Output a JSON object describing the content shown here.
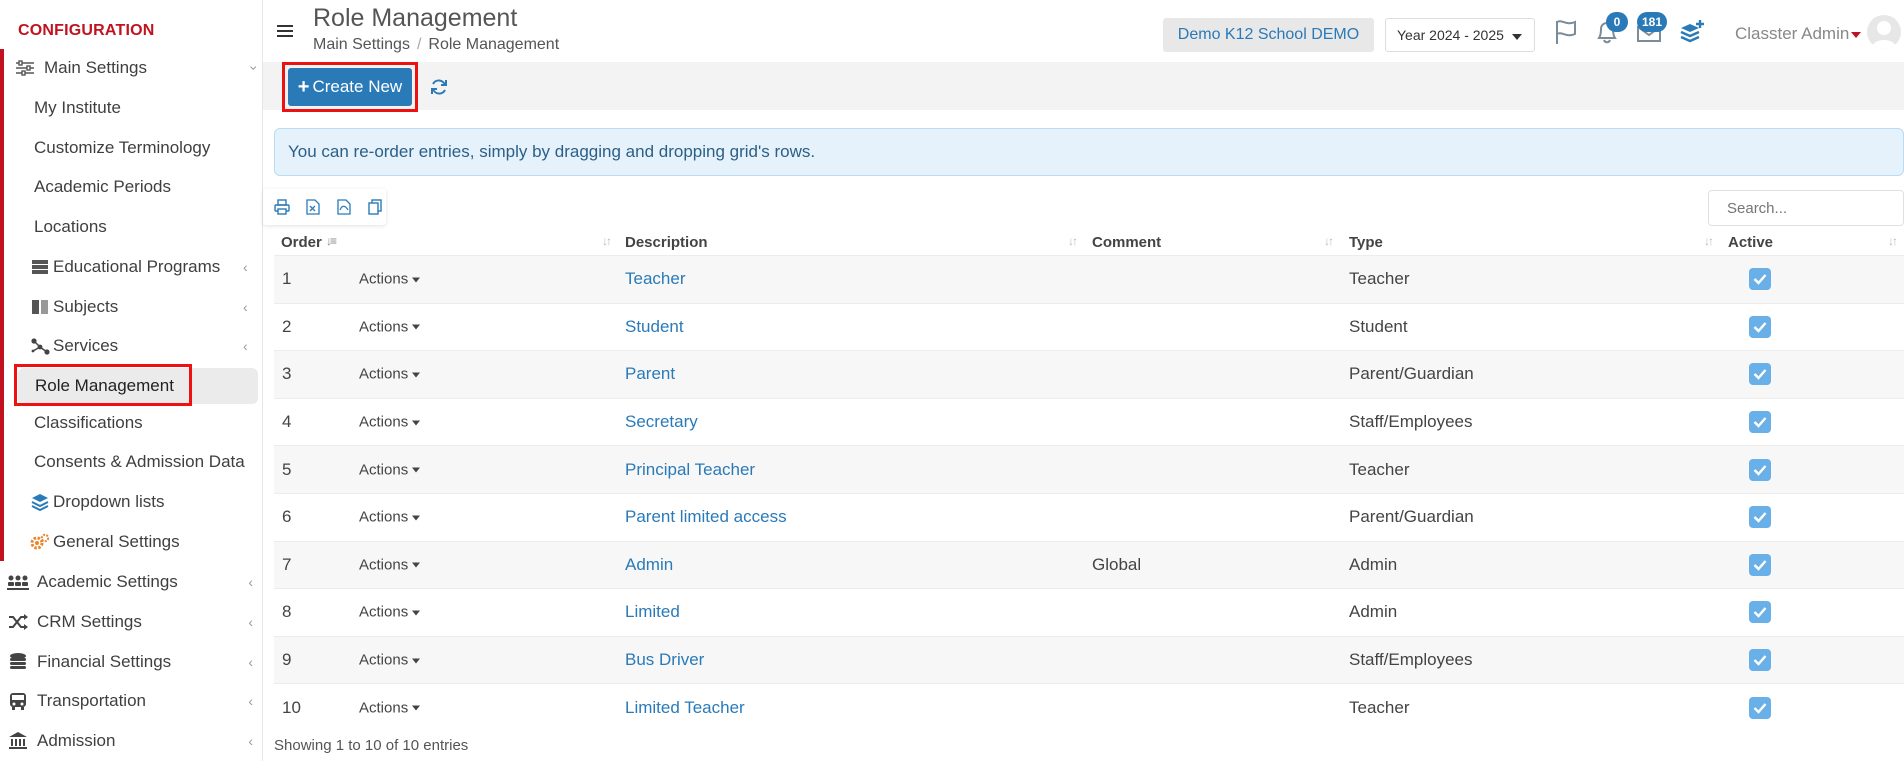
{
  "sidebar": {
    "section_title": "CONFIGURATION",
    "main_settings": "Main Settings",
    "sub_items": [
      {
        "label": "My Institute"
      },
      {
        "label": "Customize Terminology"
      },
      {
        "label": "Academic Periods"
      },
      {
        "label": "Locations"
      },
      {
        "label": "Educational Programs",
        "icon": "server-icon"
      },
      {
        "label": "Subjects",
        "icon": "book-icon"
      },
      {
        "label": "Services",
        "icon": "network-icon"
      },
      {
        "label": "Role Management",
        "active": true
      },
      {
        "label": "Classifications"
      },
      {
        "label": "Consents & Admission Data"
      },
      {
        "label": "Dropdown lists",
        "icon": "layers-icon"
      },
      {
        "label": "General Settings",
        "icon": "gears-icon"
      }
    ],
    "groups": [
      {
        "label": "Academic Settings",
        "icon": "users-icon"
      },
      {
        "label": "CRM Settings",
        "icon": "shuffle-icon"
      },
      {
        "label": "Financial Settings",
        "icon": "coins-icon"
      },
      {
        "label": "Transportation",
        "icon": "bus-icon"
      },
      {
        "label": "Admission",
        "icon": "institution-icon"
      }
    ]
  },
  "header": {
    "title": "Role Management",
    "breadcrumb": [
      "Main Settings",
      "Role Management"
    ],
    "school": "Demo K12 School DEMO",
    "year": "Year 2024 - 2025",
    "notifications_count": "0",
    "messages_count": "181",
    "user_name": "Classter Admin"
  },
  "toolbar": {
    "create_label": "Create New"
  },
  "info_message": "You can re-order entries, simply by dragging and dropping grid's rows.",
  "search": {
    "placeholder": "Search..."
  },
  "table": {
    "columns": [
      "Order",
      "Description",
      "Comment",
      "Type",
      "Active"
    ],
    "actions_label": "Actions",
    "rows": [
      {
        "order": "1",
        "description": "Teacher",
        "comment": "",
        "type": "Teacher",
        "active": true
      },
      {
        "order": "2",
        "description": "Student",
        "comment": "",
        "type": "Student",
        "active": true
      },
      {
        "order": "3",
        "description": "Parent",
        "comment": "",
        "type": "Parent/Guardian",
        "active": true
      },
      {
        "order": "4",
        "description": "Secretary",
        "comment": "",
        "type": "Staff/Employees",
        "active": true
      },
      {
        "order": "5",
        "description": "Principal Teacher",
        "comment": "",
        "type": "Teacher",
        "active": true
      },
      {
        "order": "6",
        "description": "Parent limited access",
        "comment": "",
        "type": "Parent/Guardian",
        "active": true
      },
      {
        "order": "7",
        "description": "Admin",
        "comment": "Global",
        "type": "Admin",
        "active": true
      },
      {
        "order": "8",
        "description": "Limited",
        "comment": "",
        "type": "Admin",
        "active": true
      },
      {
        "order": "9",
        "description": "Bus Driver",
        "comment": "",
        "type": "Staff/Employees",
        "active": true
      },
      {
        "order": "10",
        "description": "Limited Teacher",
        "comment": "",
        "type": "Teacher",
        "active": true
      }
    ],
    "footer": "Showing 1 to 10 of 10 entries"
  },
  "colors": {
    "accent": "#2a7ab8",
    "brand_red": "#c1121f",
    "highlight_red": "#ee1111",
    "checkbox": "#6ab0e8"
  }
}
